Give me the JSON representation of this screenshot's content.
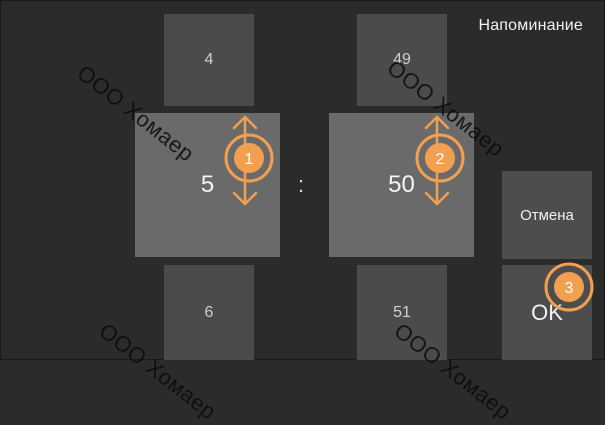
{
  "header": {
    "title": "Напоминание"
  },
  "hours": {
    "prev": "4",
    "current": "5",
    "next": "6"
  },
  "separator": ":",
  "minutes": {
    "prev": "49",
    "current": "50",
    "next": "51"
  },
  "buttons": {
    "cancel": "Отмена",
    "ok": "OK"
  },
  "watermark": {
    "text": "ООО Хомаер"
  },
  "callouts": [
    {
      "label": "1"
    },
    {
      "label": "2"
    },
    {
      "label": "3"
    }
  ],
  "colors": {
    "accent": "#f0a050",
    "background": "#2b2b2b"
  },
  "icons": [
    "up-down-arrow-icon"
  ]
}
